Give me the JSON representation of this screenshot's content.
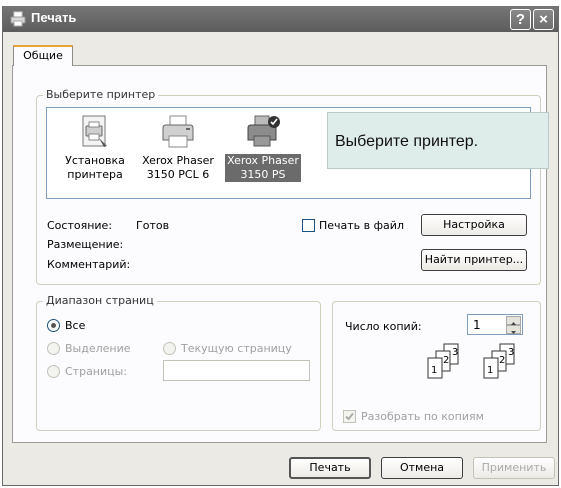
{
  "window": {
    "title": "Печать",
    "help_button": "?",
    "close_button": "×"
  },
  "tabs": [
    {
      "label": "Общие",
      "active": true
    }
  ],
  "printer_group": {
    "legend": "Выберите принтер",
    "printers": [
      {
        "label_line1": "Установка",
        "label_line2": "принтера",
        "icon": "add-printer-icon",
        "selected": false
      },
      {
        "label_line1": "Xerox Phaser",
        "label_line2": "3150 PCL 6",
        "icon": "printer-icon",
        "selected": false
      },
      {
        "label_line1": "Xerox Phaser",
        "label_line2": "3150 PS",
        "icon": "default-printer-icon",
        "selected": true
      }
    ],
    "tooltip": "Выберите принтер.",
    "status_label": "Состояние:",
    "status_value": "Готов",
    "location_label": "Размещение:",
    "comment_label": "Комментарий:",
    "print_to_file_label": "Печать в файл",
    "print_to_file_checked": false,
    "settings_button": "Настройка",
    "find_printer_button": "Найти принтер..."
  },
  "page_range": {
    "legend": "Диапазон страниц",
    "all_label": "Все",
    "selection_label": "Выделение",
    "current_page_label": "Текущую страницу",
    "pages_label": "Страницы:",
    "pages_value": "",
    "selected_option": "all"
  },
  "copies": {
    "count_label": "Число копий:",
    "count_value": "1",
    "collate_label": "Разобрать по копиям",
    "collate_checked": true,
    "collate_page_numbers": [
      "1",
      "2",
      "3"
    ]
  },
  "footer": {
    "print_button": "Печать",
    "cancel_button": "Отмена",
    "apply_button": "Применить"
  },
  "colors": {
    "titlebar": "#666666",
    "dialog_background": "#ebeae5",
    "tooltip_background": "#deecea",
    "tab_highlight": "#e8a23a",
    "selection": "#6b6b6b"
  }
}
